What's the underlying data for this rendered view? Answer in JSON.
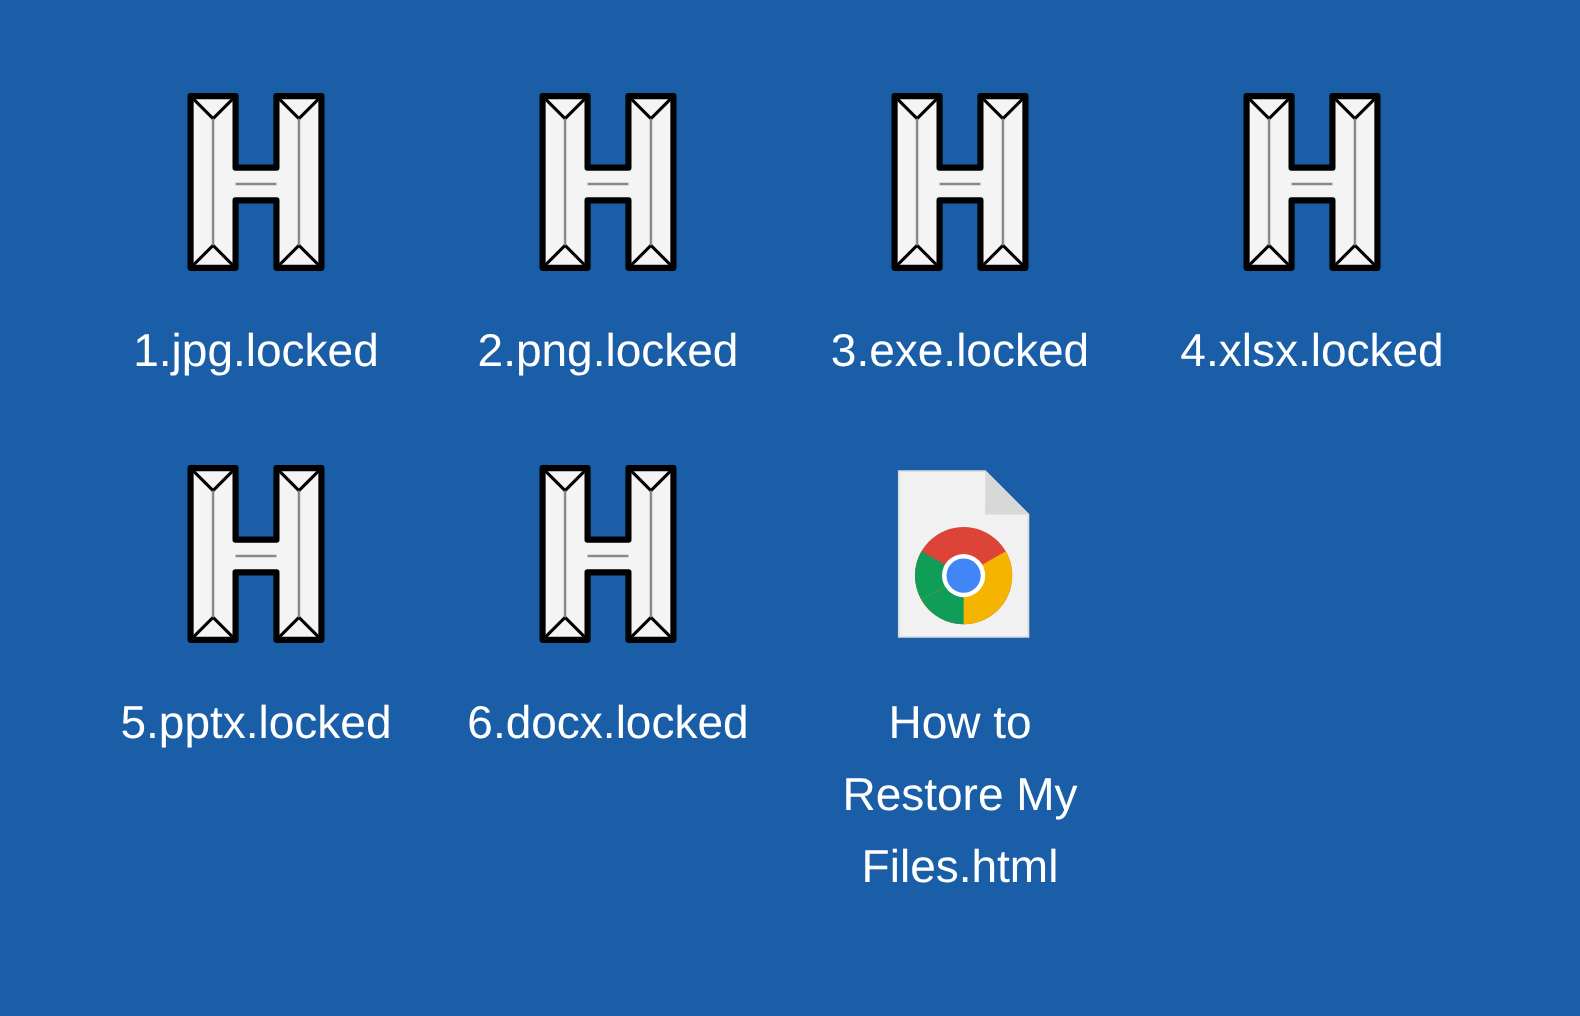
{
  "desktop_icons": [
    {
      "kind": "locked",
      "label": "1.jpg.locked"
    },
    {
      "kind": "locked",
      "label": "2.png.locked"
    },
    {
      "kind": "locked",
      "label": "3.exe.locked"
    },
    {
      "kind": "locked",
      "label": "4.xlsx.locked"
    },
    {
      "kind": "locked",
      "label": "5.pptx.locked"
    },
    {
      "kind": "locked",
      "label": "6.docx.locked"
    },
    {
      "kind": "html",
      "label": "How to Restore My Files.html"
    }
  ]
}
